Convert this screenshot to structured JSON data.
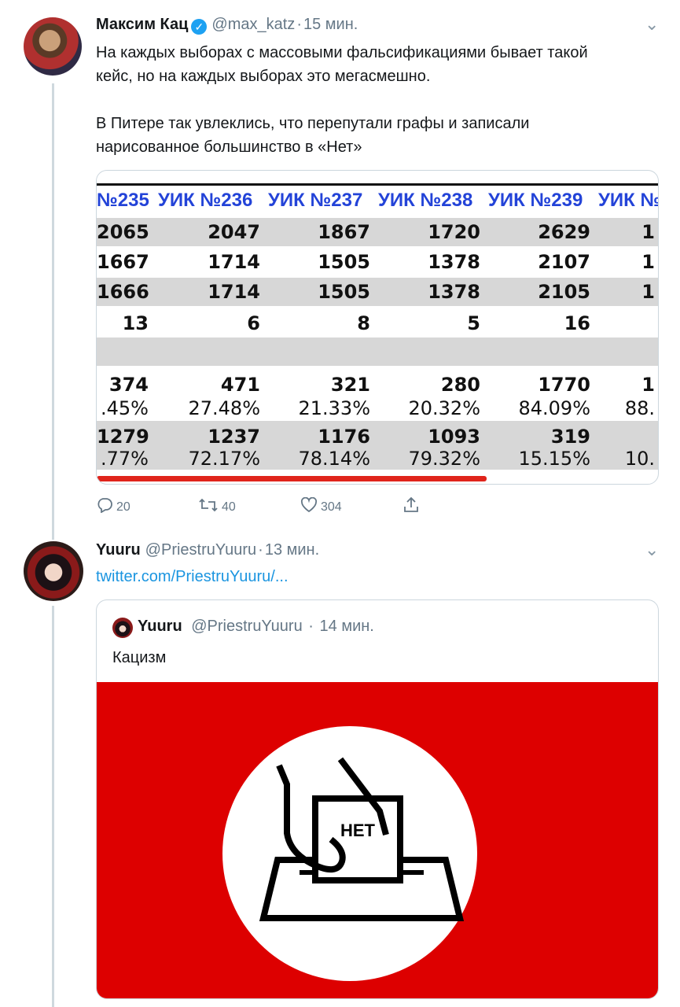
{
  "tweet1": {
    "name": "Максим Кац",
    "handle": "@max_katz",
    "time": "15 мин.",
    "text_line1": "На каждых выборах с массовыми фальсификациями бывает такой",
    "text_line2": "кейс, но на каждых выборах это мегасмешно.",
    "text_line3": "В Питере так увлеклись, что перепутали графы и записали",
    "text_line4": "нарисованное большинство в «Нет»",
    "replies": "20",
    "retweets": "40",
    "likes": "304",
    "table": {
      "headers": [
        "№235",
        "УИК №236",
        "УИК №237",
        "УИК №238",
        "УИК №239",
        "УИК №"
      ],
      "row1": [
        "2065",
        "2047",
        "1867",
        "1720",
        "2629",
        "1"
      ],
      "row2": [
        "1667",
        "1714",
        "1505",
        "1378",
        "2107",
        "1"
      ],
      "row3": [
        "1666",
        "1714",
        "1505",
        "1378",
        "2105",
        "1"
      ],
      "row4": [
        "13",
        "6",
        "8",
        "5",
        "16",
        ""
      ],
      "row5": [
        "374",
        "471",
        "321",
        "280",
        "1770",
        "1"
      ],
      "row5pct": [
        ".45%",
        "27.48%",
        "21.33%",
        "20.32%",
        "84.09%",
        "88."
      ],
      "row6": [
        "1279",
        "1237",
        "1176",
        "1093",
        "319",
        ""
      ],
      "row6pct": [
        ".77%",
        "72.17%",
        "78.14%",
        "79.32%",
        "15.15%",
        "10."
      ]
    }
  },
  "tweet2": {
    "name": "Yuuru",
    "handle": "@PriestruYuuru",
    "time": "13 мин.",
    "link": "twitter.com/PriestruYuuru/...",
    "quote": {
      "name": "Yuuru",
      "handle": "@PriestruYuuru",
      "time": "14 мин.",
      "text": "Кацизм",
      "banner_label": "НЕТ"
    }
  }
}
